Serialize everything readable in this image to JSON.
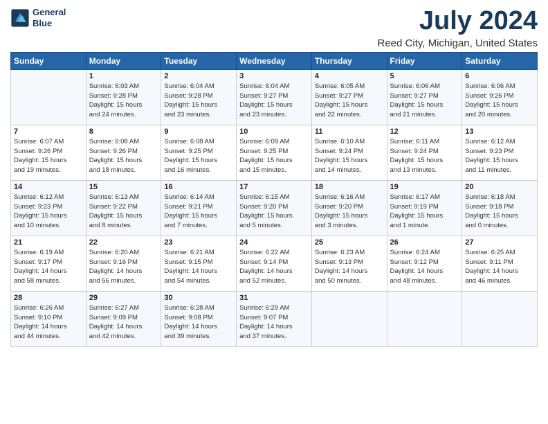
{
  "logo": {
    "line1": "General",
    "line2": "Blue"
  },
  "title": "July 2024",
  "subtitle": "Reed City, Michigan, United States",
  "days_of_week": [
    "Sunday",
    "Monday",
    "Tuesday",
    "Wednesday",
    "Thursday",
    "Friday",
    "Saturday"
  ],
  "weeks": [
    [
      {
        "num": "",
        "info": ""
      },
      {
        "num": "1",
        "info": "Sunrise: 6:03 AM\nSunset: 9:28 PM\nDaylight: 15 hours\nand 24 minutes."
      },
      {
        "num": "2",
        "info": "Sunrise: 6:04 AM\nSunset: 9:28 PM\nDaylight: 15 hours\nand 23 minutes."
      },
      {
        "num": "3",
        "info": "Sunrise: 6:04 AM\nSunset: 9:27 PM\nDaylight: 15 hours\nand 23 minutes."
      },
      {
        "num": "4",
        "info": "Sunrise: 6:05 AM\nSunset: 9:27 PM\nDaylight: 15 hours\nand 22 minutes."
      },
      {
        "num": "5",
        "info": "Sunrise: 6:06 AM\nSunset: 9:27 PM\nDaylight: 15 hours\nand 21 minutes."
      },
      {
        "num": "6",
        "info": "Sunrise: 6:06 AM\nSunset: 9:26 PM\nDaylight: 15 hours\nand 20 minutes."
      }
    ],
    [
      {
        "num": "7",
        "info": "Sunrise: 6:07 AM\nSunset: 9:26 PM\nDaylight: 15 hours\nand 19 minutes."
      },
      {
        "num": "8",
        "info": "Sunrise: 6:08 AM\nSunset: 9:26 PM\nDaylight: 15 hours\nand 18 minutes."
      },
      {
        "num": "9",
        "info": "Sunrise: 6:08 AM\nSunset: 9:25 PM\nDaylight: 15 hours\nand 16 minutes."
      },
      {
        "num": "10",
        "info": "Sunrise: 6:09 AM\nSunset: 9:25 PM\nDaylight: 15 hours\nand 15 minutes."
      },
      {
        "num": "11",
        "info": "Sunrise: 6:10 AM\nSunset: 9:24 PM\nDaylight: 15 hours\nand 14 minutes."
      },
      {
        "num": "12",
        "info": "Sunrise: 6:11 AM\nSunset: 9:24 PM\nDaylight: 15 hours\nand 13 minutes."
      },
      {
        "num": "13",
        "info": "Sunrise: 6:12 AM\nSunset: 9:23 PM\nDaylight: 15 hours\nand 11 minutes."
      }
    ],
    [
      {
        "num": "14",
        "info": "Sunrise: 6:12 AM\nSunset: 9:23 PM\nDaylight: 15 hours\nand 10 minutes."
      },
      {
        "num": "15",
        "info": "Sunrise: 6:13 AM\nSunset: 9:22 PM\nDaylight: 15 hours\nand 8 minutes."
      },
      {
        "num": "16",
        "info": "Sunrise: 6:14 AM\nSunset: 9:21 PM\nDaylight: 15 hours\nand 7 minutes."
      },
      {
        "num": "17",
        "info": "Sunrise: 6:15 AM\nSunset: 9:20 PM\nDaylight: 15 hours\nand 5 minutes."
      },
      {
        "num": "18",
        "info": "Sunrise: 6:16 AM\nSunset: 9:20 PM\nDaylight: 15 hours\nand 3 minutes."
      },
      {
        "num": "19",
        "info": "Sunrise: 6:17 AM\nSunset: 9:19 PM\nDaylight: 15 hours\nand 1 minute."
      },
      {
        "num": "20",
        "info": "Sunrise: 6:18 AM\nSunset: 9:18 PM\nDaylight: 15 hours\nand 0 minutes."
      }
    ],
    [
      {
        "num": "21",
        "info": "Sunrise: 6:19 AM\nSunset: 9:17 PM\nDaylight: 14 hours\nand 58 minutes."
      },
      {
        "num": "22",
        "info": "Sunrise: 6:20 AM\nSunset: 9:16 PM\nDaylight: 14 hours\nand 56 minutes."
      },
      {
        "num": "23",
        "info": "Sunrise: 6:21 AM\nSunset: 9:15 PM\nDaylight: 14 hours\nand 54 minutes."
      },
      {
        "num": "24",
        "info": "Sunrise: 6:22 AM\nSunset: 9:14 PM\nDaylight: 14 hours\nand 52 minutes."
      },
      {
        "num": "25",
        "info": "Sunrise: 6:23 AM\nSunset: 9:13 PM\nDaylight: 14 hours\nand 50 minutes."
      },
      {
        "num": "26",
        "info": "Sunrise: 6:24 AM\nSunset: 9:12 PM\nDaylight: 14 hours\nand 48 minutes."
      },
      {
        "num": "27",
        "info": "Sunrise: 6:25 AM\nSunset: 9:11 PM\nDaylight: 14 hours\nand 46 minutes."
      }
    ],
    [
      {
        "num": "28",
        "info": "Sunrise: 6:26 AM\nSunset: 9:10 PM\nDaylight: 14 hours\nand 44 minutes."
      },
      {
        "num": "29",
        "info": "Sunrise: 6:27 AM\nSunset: 9:09 PM\nDaylight: 14 hours\nand 42 minutes."
      },
      {
        "num": "30",
        "info": "Sunrise: 6:28 AM\nSunset: 9:08 PM\nDaylight: 14 hours\nand 39 minutes."
      },
      {
        "num": "31",
        "info": "Sunrise: 6:29 AM\nSunset: 9:07 PM\nDaylight: 14 hours\nand 37 minutes."
      },
      {
        "num": "",
        "info": ""
      },
      {
        "num": "",
        "info": ""
      },
      {
        "num": "",
        "info": ""
      }
    ]
  ]
}
